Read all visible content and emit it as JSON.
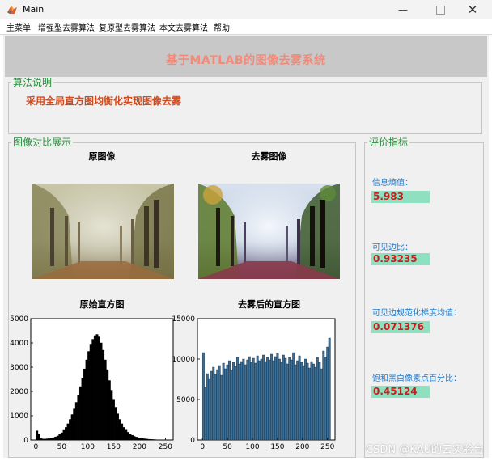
{
  "window": {
    "title": "Main",
    "minimize_icon": "minimize-icon",
    "maximize_icon": "maximize-icon",
    "close_icon": "close-icon"
  },
  "menu": {
    "items": [
      "主菜单",
      "增强型去雾算法",
      "复原型去雾算法",
      "本文去雾算法",
      "帮助"
    ]
  },
  "banner": {
    "title": "基于MATLAB的图像去雾系统"
  },
  "algorithm_panel": {
    "legend": "算法说明",
    "description": "采用全局直方图均衡化实现图像去雾"
  },
  "compare_panel": {
    "legend": "图像对比展示",
    "original_title": "原图像",
    "dehazed_title": "去雾图像",
    "original_hist_title": "原始直方图",
    "dehazed_hist_title": "去雾后的直方图"
  },
  "metrics_panel": {
    "legend": "评价指标",
    "items": [
      {
        "label": "信息熵值：",
        "value": "5.983"
      },
      {
        "label": "可见边比：",
        "value": "0.93235"
      },
      {
        "label": "可见边规范化梯度均值：",
        "value": "0.071376"
      },
      {
        "label": "饱和黑白像素点百分比：",
        "value": "0.45124"
      }
    ]
  },
  "watermark": "CSDN @KAU的云实验台",
  "colors": {
    "banner_bg": "#c8c8c8",
    "banner_text": "#f08a7a",
    "legend_text": "#2a8c3c",
    "description_text": "#d14b1e",
    "metric_label": "#1e7bd1",
    "metric_box_bg": "#8fe0c0",
    "metric_value": "#c81e1e",
    "hist_original_bar": "#000000",
    "hist_dehazed_bar": "#3a6e96"
  },
  "chart_data": [
    {
      "type": "bar",
      "title": "原始直方图",
      "xlabel": "",
      "ylabel": "",
      "xlim": [
        -10,
        265
      ],
      "ylim": [
        0,
        5000
      ],
      "xticks": [
        0,
        50,
        100,
        150,
        200,
        250
      ],
      "yticks": [
        0,
        1000,
        2000,
        3000,
        4000,
        5000
      ],
      "ytick_labels": [
        "0",
        "1000",
        "2000",
        "3000",
        "4000",
        "5000"
      ],
      "grid": false,
      "x_start": 0,
      "bin_width": 4,
      "values": [
        380,
        250,
        60,
        40,
        40,
        50,
        60,
        80,
        100,
        130,
        170,
        230,
        300,
        400,
        520,
        670,
        850,
        1050,
        1280,
        1550,
        1860,
        2200,
        2560,
        2930,
        3300,
        3650,
        3950,
        4150,
        4300,
        4350,
        4250,
        4000,
        3700,
        3300,
        2900,
        2450,
        2050,
        1680,
        1350,
        1080,
        850,
        670,
        520,
        410,
        320,
        250,
        195,
        150,
        120,
        95,
        75,
        60,
        50,
        40,
        30,
        25,
        20,
        15,
        10,
        8,
        6,
        5,
        3,
        2
      ]
    },
    {
      "type": "bar",
      "title": "去雾后的直方图",
      "xlabel": "",
      "ylabel": "",
      "xlim": [
        -10,
        265
      ],
      "ylim": [
        0,
        15000
      ],
      "xticks": [
        0,
        50,
        100,
        150,
        200,
        250
      ],
      "yticks": [
        0,
        5000,
        10000,
        15000
      ],
      "ytick_labels": [
        "0",
        "5000",
        "10000",
        "15000"
      ],
      "grid": false,
      "x_start": 0,
      "bin_width": 4,
      "values": [
        10800,
        6500,
        8200,
        7600,
        8500,
        9000,
        8100,
        8700,
        9200,
        8000,
        9500,
        8800,
        9300,
        9800,
        8600,
        9600,
        9100,
        10200,
        9400,
        9700,
        10000,
        9300,
        9900,
        10300,
        9600,
        10100,
        9500,
        10400,
        9800,
        10000,
        10500,
        9700,
        10200,
        9900,
        10600,
        9800,
        10300,
        10700,
        10000,
        9600,
        10500,
        10100,
        9400,
        10200,
        9900,
        10800,
        9300,
        9800,
        10400,
        9600,
        9200,
        10000,
        9500,
        8900,
        9700,
        9400,
        9000,
        10200,
        9600,
        8800,
        11000,
        10200,
        11500,
        12600
      ]
    }
  ]
}
